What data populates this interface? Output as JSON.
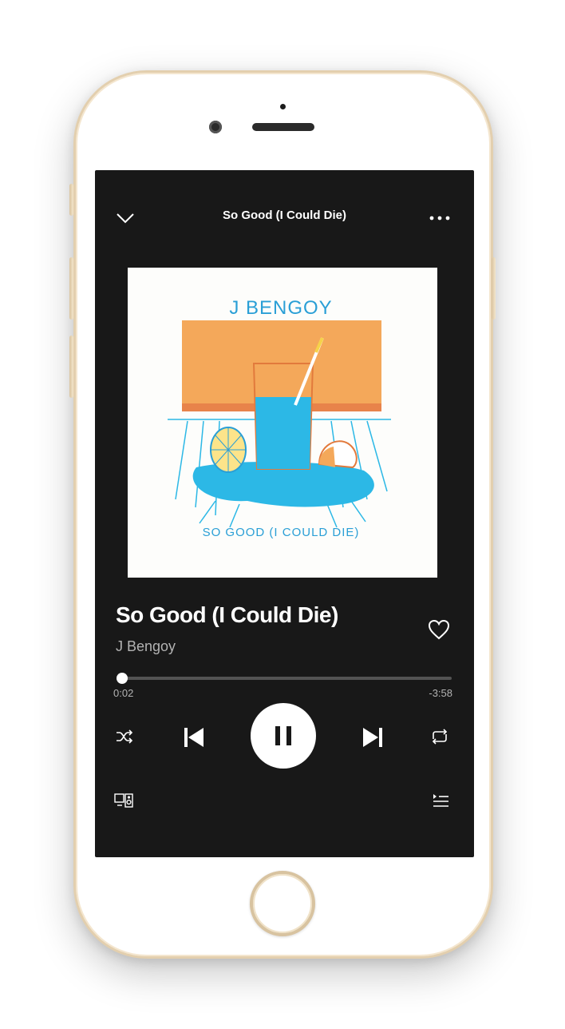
{
  "header": {
    "title": "So Good (I Could Die)",
    "collapse_icon": "chevron-down-icon",
    "more_icon": "more-dots-icon"
  },
  "album_art": {
    "artist_lettering": "J BENGOY",
    "title_lettering": "SO GOOD (I COULD DIE)",
    "colors": {
      "orange": "#f4a85a",
      "blue": "#2cb8e6",
      "background": "#fdfdfb"
    }
  },
  "track": {
    "title": "So Good (I Could Die)",
    "artist": "J Bengoy",
    "like_icon": "heart-outline-icon"
  },
  "progress": {
    "elapsed": "0:02",
    "remaining": "-3:58",
    "fraction": 0.008
  },
  "controls": {
    "shuffle_icon": "shuffle-icon",
    "previous_icon": "skip-previous-icon",
    "play_pause_icon": "pause-icon",
    "next_icon": "skip-next-icon",
    "repeat_icon": "repeat-icon"
  },
  "footer": {
    "devices_icon": "connect-devices-icon",
    "queue_icon": "queue-icon"
  },
  "colors": {
    "screen_bg": "#181818",
    "text_primary": "#ffffff",
    "text_secondary": "#b3b3b3",
    "phone_frame": "#e3cfae"
  }
}
